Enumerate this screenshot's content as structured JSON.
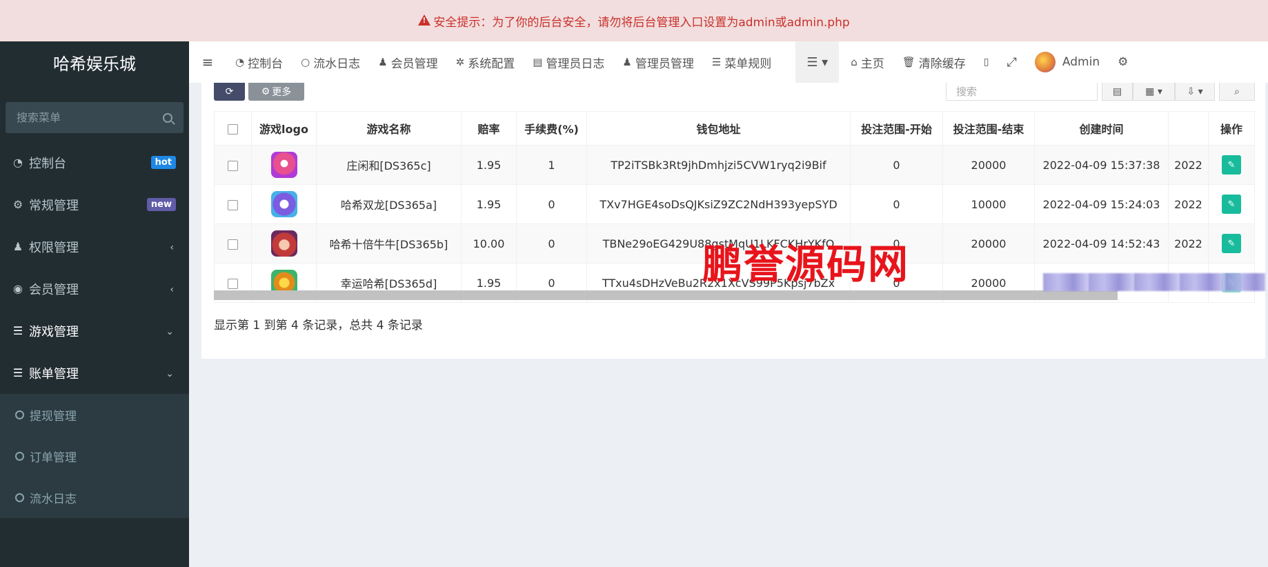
{
  "warning": {
    "text": "安全提示：为了你的后台安全，请勿将后台管理入口设置为admin或admin.php"
  },
  "sidebar": {
    "logo": "哈希娱乐城",
    "search_placeholder": "搜索菜单",
    "items": [
      {
        "label": "控制台",
        "icon": "dashboard-icon",
        "badge": "hot"
      },
      {
        "label": "常规管理",
        "icon": "cogs-icon",
        "badge": "new"
      },
      {
        "label": "权限管理",
        "icon": "group-icon",
        "caret": "‹"
      },
      {
        "label": "会员管理",
        "icon": "user-circle-icon",
        "caret": "‹"
      },
      {
        "label": "游戏管理",
        "icon": "list-icon",
        "caret": "⌄"
      },
      {
        "label": "账单管理",
        "icon": "list-icon",
        "caret": "⌄"
      }
    ],
    "subitems": [
      {
        "label": "提现管理"
      },
      {
        "label": "订单管理"
      },
      {
        "label": "流水日志"
      }
    ]
  },
  "navbar": {
    "items": [
      {
        "label": "控制台",
        "icon": "dashboard-icon"
      },
      {
        "label": "流水日志",
        "icon": "circle-icon"
      },
      {
        "label": "会员管理",
        "icon": "user-icon"
      },
      {
        "label": "系统配置",
        "icon": "gear-icon"
      },
      {
        "label": "管理员日志",
        "icon": "list-alt-icon"
      },
      {
        "label": "管理员管理",
        "icon": "user-icon"
      },
      {
        "label": "菜单规则",
        "icon": "bars-icon"
      }
    ],
    "home": "主页",
    "clear_cache": "清除缓存",
    "admin": "Admin"
  },
  "toolbar": {
    "more": "更多",
    "search_placeholder": "搜索"
  },
  "table": {
    "headers": [
      "游戏logo",
      "游戏名称",
      "赔率",
      "手续费(%)",
      "钱包地址",
      "投注范围-开始",
      "投注范围-结束",
      "创建时间",
      "",
      "操作"
    ],
    "rows": [
      {
        "name": "庄闲和[DS365c]",
        "odds": "1.95",
        "fee": "1",
        "wallet": "TP2iTSBk3Rt9jhDmhjzi5CVW1ryq2i9Bif",
        "start": "0",
        "end": "20000",
        "created": "2022-04-09 15:37:38",
        "extra": "2022"
      },
      {
        "name": "哈希双龙[DS365a]",
        "odds": "1.95",
        "fee": "0",
        "wallet": "TXv7HGE4soDsQJKsiZ9ZC2NdH393yepSYD",
        "start": "0",
        "end": "10000",
        "created": "2022-04-09 15:24:03",
        "extra": "2022"
      },
      {
        "name": "哈希十倍牛牛[DS365b]",
        "odds": "10.00",
        "fee": "0",
        "wallet": "TBNe29oEG429U88gstMqU1LKFCKHrYKfQ",
        "start": "0",
        "end": "20000",
        "created": "2022-04-09 14:52:43",
        "extra": "2022"
      },
      {
        "name": "幸运哈希[DS365d]",
        "odds": "1.95",
        "fee": "0",
        "wallet": "TTxu4sDHzVeBu2R2x1XcVS99P5Kpsj7bZx",
        "start": "0",
        "end": "20000",
        "created": "",
        "extra": ""
      }
    ]
  },
  "summary": "显示第 1 到第 4 条记录，总共 4 条记录",
  "watermark": "鹏誉源码网",
  "colors": {
    "warning_bg": "#f2dede",
    "warning_text": "#c9302c",
    "sidebar_bg": "#222d32",
    "edit_button": "#18bc9c",
    "watermark": "#e8141b"
  }
}
